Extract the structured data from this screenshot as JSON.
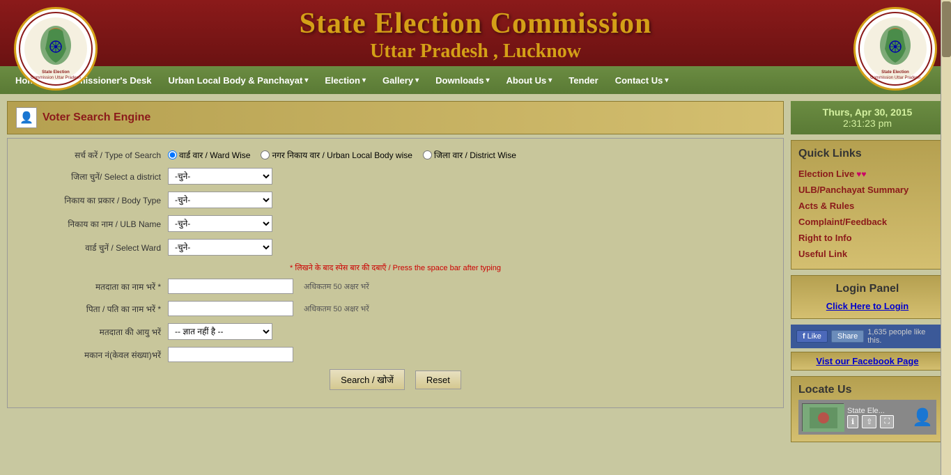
{
  "header": {
    "title": "State Election Commission",
    "subtitle": "Uttar Pradesh , Lucknow"
  },
  "navbar": {
    "items": [
      {
        "label": "Home",
        "has_dropdown": false
      },
      {
        "label": "Commissioner's Desk",
        "has_dropdown": false
      },
      {
        "label": "Urban Local Body & Panchayat",
        "has_dropdown": true
      },
      {
        "label": "Election",
        "has_dropdown": true
      },
      {
        "label": "Gallery",
        "has_dropdown": true
      },
      {
        "label": "Downloads",
        "has_dropdown": true
      },
      {
        "label": "About Us",
        "has_dropdown": true
      },
      {
        "label": "Tender",
        "has_dropdown": false
      },
      {
        "label": "Contact Us",
        "has_dropdown": true
      }
    ]
  },
  "voter_search": {
    "title": "Voter Search Engine",
    "search_types": [
      {
        "value": "ward",
        "label": "वार्ड वार / Ward Wise",
        "checked": true
      },
      {
        "value": "ulb",
        "label": "नगर निकाय वार / Urban Local Body wise",
        "checked": false
      },
      {
        "value": "district",
        "label": "जिला वार / District Wise",
        "checked": false
      }
    ],
    "district_label": "जिला चुनें/  Select a district",
    "district_placeholder": "-चुने-",
    "body_type_label": "निकाय का प्रकार / Body Type",
    "body_type_placeholder": "-चुने-",
    "ulb_name_label": "निकाय का नाम / ULB Name",
    "ulb_name_placeholder": "-चुने-",
    "ward_label": "वार्ड चुनें / Select Ward",
    "ward_placeholder": "-चुने-",
    "hint_text": "* लिखने के बाद स्पेस बार की दबाएँ / Press the space bar after typing",
    "voter_name_label": "मतदाता का नाम भरें *",
    "voter_name_hint": "अधिकतम 50 अक्षर भरें",
    "father_name_label": "पिता / पति का नाम भरें *",
    "father_name_hint": "अधिकतम 50 अक्षर भरें",
    "age_label": "मतदाता की आयु भरें",
    "age_placeholder": "-- ज्ञात नहीं है --",
    "house_no_label": "मकान नं(केवल संख्या)भरें",
    "search_btn": "Search / खोजें",
    "reset_btn": "Reset",
    "type_of_search_label": "सर्च करें / Type of Search"
  },
  "right_panel": {
    "datetime": {
      "date": "Thurs, Apr 30, 2015",
      "time": "2:31:23 pm"
    },
    "quick_links": {
      "title": "Quick Links",
      "items": [
        {
          "label": "Election Live",
          "extra": "♥♥",
          "has_hearts": true
        },
        {
          "label": "ULB/Panchayat Summary"
        },
        {
          "label": "Acts & Rules"
        },
        {
          "label": "Complaint/Feedback"
        },
        {
          "label": "Right to Info"
        },
        {
          "label": "Useful Link"
        }
      ]
    },
    "login_panel": {
      "title": "Login Panel",
      "link_label": "Click Here to Login"
    },
    "facebook": {
      "like_label": "Like",
      "share_label": "Share",
      "count": "1,635 people like this."
    },
    "visit_fb": "Vist our Facebook Page",
    "locate_us": {
      "title": "Locate Us",
      "map_label": "State Ele..."
    }
  }
}
